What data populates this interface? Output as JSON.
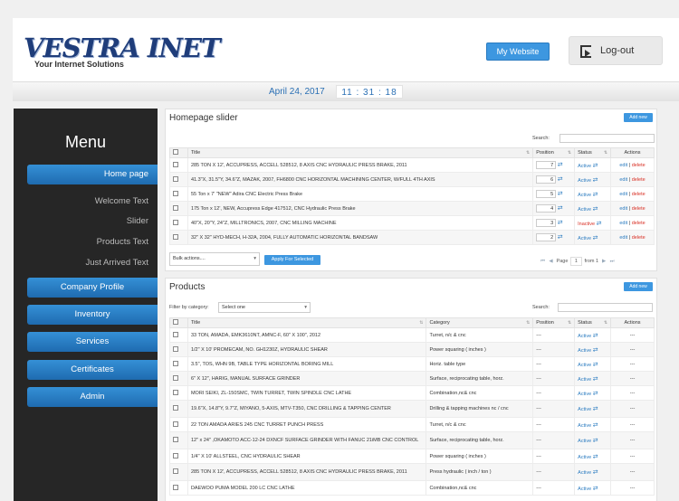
{
  "header": {
    "logo": "VESTRA INET",
    "tagline": "Your Internet Solutions",
    "my_website": "My Website",
    "logout": "Log-out"
  },
  "datebar": {
    "date": "April 24, 2017",
    "time": "11 : 31 : 18"
  },
  "sidebar": {
    "title": "Menu",
    "items": [
      {
        "label": "Home page",
        "type": "button"
      },
      {
        "label": "Welcome Text",
        "type": "sub"
      },
      {
        "label": "Slider",
        "type": "sub"
      },
      {
        "label": "Products Text",
        "type": "sub"
      },
      {
        "label": "Just Arrived Text",
        "type": "sub"
      },
      {
        "label": "Company Profile",
        "type": "button"
      },
      {
        "label": "Inventory",
        "type": "button"
      },
      {
        "label": "Services",
        "type": "button"
      },
      {
        "label": "Certificates",
        "type": "button"
      },
      {
        "label": "Admin",
        "type": "button"
      }
    ]
  },
  "slider": {
    "title": "Homepage slider",
    "add_new": "Add new",
    "search_label": "Search:",
    "columns": [
      "Title",
      "Position",
      "Status",
      "Actions"
    ],
    "rows": [
      {
        "title": "285 TON X 12', ACCUPRESS, ACCELL 528512, 8 AXIS CNC HYDRAULIC PRESS BRAKE, 2011",
        "position": "7",
        "status": "Active"
      },
      {
        "title": "41.3\"X, 31.5\"Y, 34.6\"Z, MAZAK, 2007, FH6800 CNC HORIZONTAL MACHINING CENTER, W/FULL 4TH AXIS",
        "position": "6",
        "status": "Active"
      },
      {
        "title": "55 Ton x 7' \"NEW\" Adira CNC Electric Press Brake",
        "position": "5",
        "status": "Active"
      },
      {
        "title": "175 Ton x 12', NEW, Accupress Edge 417512, CNC Hydraulic Press Brake",
        "position": "4",
        "status": "Active"
      },
      {
        "title": "40\"X, 20\"Y, 24\"Z, MILLTRONICS, 2007, CNC MILLING MACHINE",
        "position": "3",
        "status": "Inactive"
      },
      {
        "title": "32\" X 32\" HYD-MECH, H-32A, 2004, FULLY AUTOMATIC HORIZONTAL BANDSAW",
        "position": "2",
        "status": "Active"
      }
    ],
    "edit": "edit",
    "delete": "delete",
    "bulk_actions": "Bulk actions....",
    "apply": "Apply For Selected",
    "page_label": "Page",
    "page_num": "1",
    "from_label": "from",
    "page_total": "1"
  },
  "products": {
    "title": "Products",
    "add_new": "Add new",
    "filter_label": "Filter by category:",
    "filter_value": "Select one",
    "search_label": "Search:",
    "columns": [
      "Title",
      "Category",
      "Position",
      "Status",
      "Actions"
    ],
    "rows": [
      {
        "title": "33 TON, AMADA, EMK3610NT, AMNC-F, 60\" X 100\", 2012",
        "category": "Turret, n/c & cnc",
        "position": "---",
        "status": "Active",
        "actions": "---"
      },
      {
        "title": "1/2\" X 10' PROMECAM, NO. GH1230Z, HYDRAULIC SHEAR",
        "category": "Power squaring ( inches )",
        "position": "---",
        "status": "Active",
        "actions": "---"
      },
      {
        "title": "3.5\", TOS, WHN 9B, TABLE TYPE HORIZONTAL BORING MILL",
        "category": "Horiz. table type",
        "position": "---",
        "status": "Active",
        "actions": "---"
      },
      {
        "title": "6\" X 12\", HARIG, MANUAL SURFACE GRINDER",
        "category": "Surface, reciprocating table, horz.",
        "position": "---",
        "status": "Active",
        "actions": "---"
      },
      {
        "title": "MORI SEIKI, ZL-150SMC, TWIN TURRET, TWIN SPINDLE CNC LATHE",
        "category": "Combination,nc& cnc",
        "position": "---",
        "status": "Active",
        "actions": "---"
      },
      {
        "title": "19.6\"X, 14.8\"Y, 9.7\"Z, MIYANO, 5-AXIS, MTV-T350, CNC DRILLING & TAPPING CENTER",
        "category": "Drilling & tapping machines nc / cnc",
        "position": "---",
        "status": "Active",
        "actions": "---"
      },
      {
        "title": "22 TON AMADA ARIES 245 CNC TURRET PUNCH PRESS",
        "category": "Turret, n/c & cnc",
        "position": "---",
        "status": "Active",
        "actions": "---"
      },
      {
        "title": "12\" x 24\" ,OKAMOTO ACC-12-24 DXNCF SURFACE GRINDER WITH FANUC 21iMB CNC CONTROL",
        "category": "Surface, reciprocating table, horz.",
        "position": "---",
        "status": "Active",
        "actions": "---"
      },
      {
        "title": "1/4\" X 10' ALLSTEEL, CNC HYDRAULIC SHEAR",
        "category": "Power squaring ( inches )",
        "position": "---",
        "status": "Active",
        "actions": "---"
      },
      {
        "title": "285 TON X 12', ACCUPRESS, ACCELL 528512, 8 AXIS CNC HYDRAULIC PRESS BRAKE, 2011",
        "category": "Press hydraulic ( inch / ton )",
        "position": "---",
        "status": "Active",
        "actions": "---"
      },
      {
        "title": "DAEWOO PUMA MODEL 200 LC CNC LATHE",
        "category": "Combination,nc& cnc",
        "position": "---",
        "status": "Active",
        "actions": "---"
      }
    ]
  }
}
